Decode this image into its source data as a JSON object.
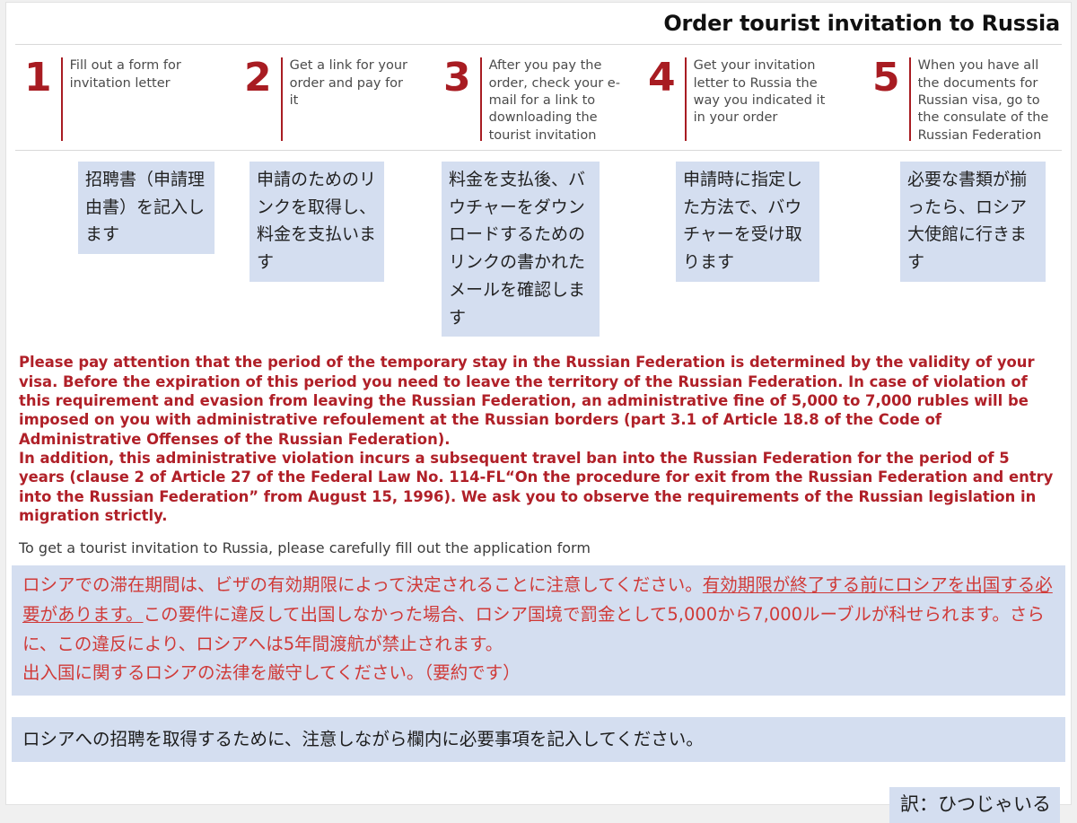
{
  "header": {
    "title": "Order tourist invitation to Russia"
  },
  "steps": [
    {
      "number": "1",
      "text": "Fill out a form for invitation letter",
      "jp": "招聘書（申請理由書）を記入します"
    },
    {
      "number": "2",
      "text": "Get a link for your order and pay for it",
      "jp": "申請のためのリンクを取得し、料金を支払います"
    },
    {
      "number": "3",
      "text": "After you pay the order, check your e-mail for a link to downloading the tourist invitation",
      "jp": "料金を支払後、バウチャーをダウンロードするためのリンクの書かれたメールを確認します"
    },
    {
      "number": "4",
      "text": "Get your invitation letter to Russia the way you indicated it in your order",
      "jp": "申請時に指定した方法で、バウチャーを受け取ります"
    },
    {
      "number": "5",
      "text": "When you have all the documents for Russian visa, go to the consulate of the Russian Federation",
      "jp": "必要な書類が揃ったら、ロシア大使館に行きます"
    }
  ],
  "warning": {
    "paragraph1": "Please pay attention that the period of the temporary stay in the Russian Federation is determined by the validity of your visa. Before the expiration of this period you need to leave the territory of the Russian Federation. In case of violation of this requirement and evasion from leaving the Russian Federation, an administrative fine of 5,000 to 7,000 rubles will be imposed on you with administrative refoulement at the Russian borders (part 3.1 of Article 18.8 of the Code of Administrative Offenses of the Russian Federation).",
    "paragraph2": "In addition, this administrative violation incurs a subsequent travel ban into the Russian Federation for the period of 5 years (clause 2 of Article 27 of the Federal Law No. 114-FL“On the procedure for exit from the Russian Federation and entry into the Russian Federation” from August 15, 1996). We ask you to observe the requirements of the Russian legislation in migration strictly."
  },
  "note": {
    "text": "To get a tourist invitation to Russia, please carefully fill out the application form"
  },
  "jp_warning": {
    "part1": "ロシアでの滞在期間は、ビザの有効期限によって決定されることに注意してください。",
    "part2_underlined": "有効期限が終了する前にロシアを出国する必要があります。",
    "part3": "この要件に違反して出国しなかった場合、ロシア国境で罰金として5,000から7,000ルーブルが科せられます。さらに、この違反により、ロシアへは5年間渡航が禁止されます。",
    "part4": "出入国に関するロシアの法律を厳守してください。（要約です）"
  },
  "jp_instruction": {
    "text": "ロシアへの招聘を取得するために、注意しながら欄内に必要事項を記入してください。"
  },
  "credit": {
    "text": "訳：ひつじゃいる"
  },
  "colors": {
    "accent_red": "#a81c22",
    "warning_red": "#b02028",
    "jp_red": "#d03a38",
    "highlight_blue": "#d4def0",
    "step_text_gray": "#4b4b4b"
  }
}
